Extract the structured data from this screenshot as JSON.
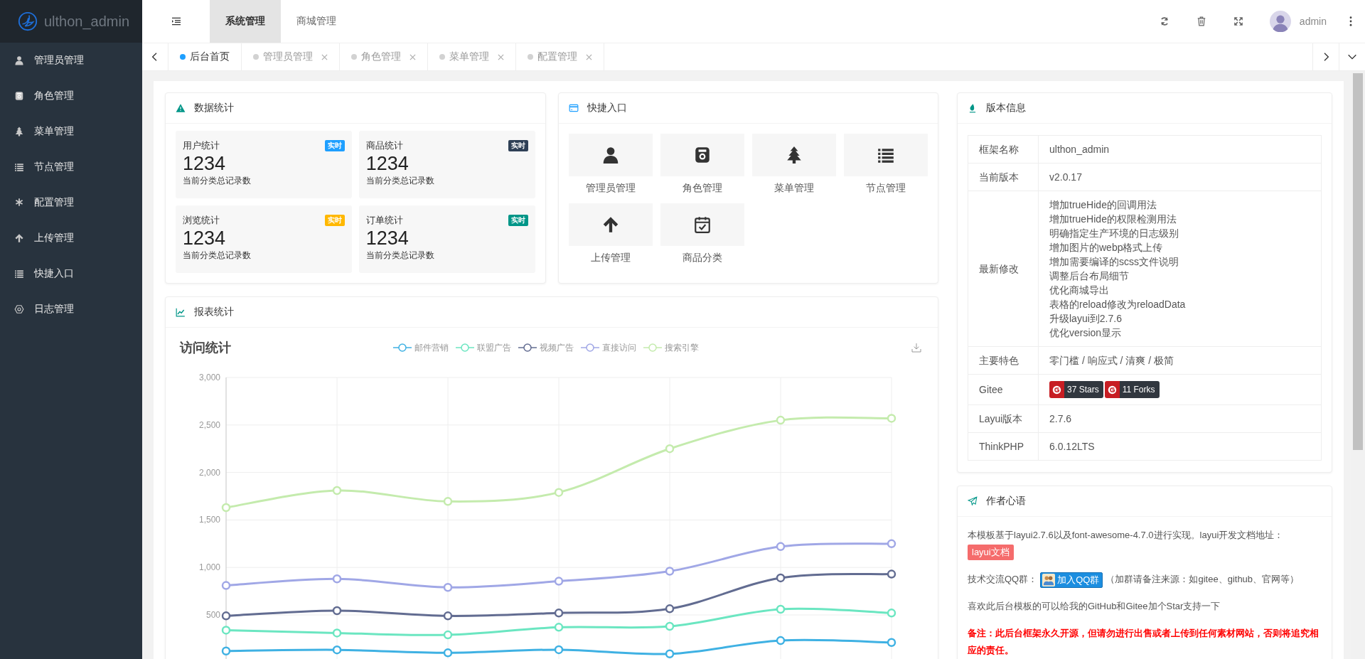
{
  "sidebar": {
    "logo": "ulthon_admin",
    "items": [
      {
        "label": "管理员管理"
      },
      {
        "label": "角色管理"
      },
      {
        "label": "菜单管理"
      },
      {
        "label": "节点管理"
      },
      {
        "label": "配置管理"
      },
      {
        "label": "上传管理"
      },
      {
        "label": "快捷入口"
      },
      {
        "label": "日志管理"
      }
    ]
  },
  "header": {
    "top_tabs": [
      {
        "label": "系统管理",
        "selected": true
      },
      {
        "label": "商城管理",
        "selected": false
      }
    ],
    "user": "admin"
  },
  "page_tabs": [
    {
      "label": "后台首页",
      "selected": true,
      "closable": false
    },
    {
      "label": "管理员管理",
      "selected": false,
      "closable": true
    },
    {
      "label": "角色管理",
      "selected": false,
      "closable": true
    },
    {
      "label": "菜单管理",
      "selected": false,
      "closable": true
    },
    {
      "label": "配置管理",
      "selected": false,
      "closable": true
    }
  ],
  "stats": {
    "title": "数据统计",
    "tiles": [
      {
        "title": "用户统计",
        "badge": "实时",
        "color": "#1e9fff",
        "value": "1234",
        "note": "当前分类总记录数"
      },
      {
        "title": "商品统计",
        "badge": "实时",
        "color": "#2f4056",
        "value": "1234",
        "note": "当前分类总记录数"
      },
      {
        "title": "浏览统计",
        "badge": "实时",
        "color": "#ffb800",
        "value": "1234",
        "note": "当前分类总记录数"
      },
      {
        "title": "订单统计",
        "badge": "实时",
        "color": "#009688",
        "value": "1234",
        "note": "当前分类总记录数"
      }
    ]
  },
  "shortcuts": {
    "title": "快捷入口",
    "items": [
      "管理员管理",
      "角色管理",
      "菜单管理",
      "节点管理",
      "上传管理",
      "商品分类"
    ]
  },
  "report": {
    "title": "报表统计",
    "chart_data": {
      "type": "line",
      "title": "访问统计",
      "ylim": [
        0,
        3000
      ],
      "grid": true,
      "yticks": [
        500,
        {
          "value": 1000,
          "label": "1,000"
        },
        {
          "value": 1500,
          "label": "1,500"
        },
        {
          "value": 2000,
          "label": "2,000"
        },
        {
          "value": 2500,
          "label": "2,500"
        },
        {
          "value": 3000,
          "label": "3,000"
        }
      ],
      "series": [
        {
          "name": "邮件营销",
          "color": "#3fb1e3",
          "marker": true,
          "values": [
            120,
            132,
            101,
            134,
            90,
            230,
            210
          ]
        },
        {
          "name": "联盟广告",
          "color": "#6be6c1",
          "marker": true,
          "values": [
            340,
            310,
            290,
            370,
            380,
            560,
            520
          ]
        },
        {
          "name": "视频广告",
          "color": "#626c91",
          "marker": true,
          "values": [
            490,
            545,
            490,
            520,
            565,
            890,
            930
          ]
        },
        {
          "name": "直接访问",
          "color": "#a0a7e6",
          "marker": true,
          "values": [
            810,
            880,
            790,
            855,
            960,
            1220,
            1250
          ]
        },
        {
          "name": "搜索引擎",
          "color": "#c4ebad",
          "marker": true,
          "values": [
            1630,
            1810,
            1695,
            1790,
            2250,
            2550,
            2570
          ]
        }
      ]
    }
  },
  "version": {
    "title": "版本信息",
    "rows": [
      {
        "kind": "text",
        "label": "框架名称",
        "value": "ulthon_admin"
      },
      {
        "kind": "text",
        "label": "当前版本",
        "value": "v2.0.17"
      },
      {
        "kind": "lines",
        "label": "最新修改",
        "lines": [
          "增加trueHide的回调用法",
          "增加trueHide的权限检测用法",
          "明确指定生产环境的日志级别",
          "增加图片的webp格式上传",
          "增加需要编译的scss文件说明",
          "调整后台布局细节",
          "优化商城导出",
          "表格的reload修改为reloadData",
          "升级layui到2.7.6",
          "优化version显示"
        ]
      },
      {
        "kind": "text",
        "label": "主要特色",
        "value": "零门槛 / 响应式 / 清爽 / 极简"
      },
      {
        "kind": "badges",
        "label": "Gitee",
        "badges": [
          "37 Stars",
          "11 Forks"
        ]
      },
      {
        "kind": "text",
        "label": "Layui版本",
        "value": "2.7.6"
      },
      {
        "kind": "text",
        "label": "ThinkPHP",
        "value": "6.0.12LTS"
      }
    ]
  },
  "author": {
    "title": "作者心语",
    "paragraphs": [
      {
        "kind": "link",
        "text": "本模板基于layui2.7.6以及font-awesome-4.7.0进行实现。layui开发文档地址：",
        "link": "layui文档"
      },
      {
        "kind": "qq",
        "text": "技术交流QQ群：",
        "button": "加入QQ群",
        "after": "（加群请备注来源：如gitee、github、官网等）"
      },
      {
        "kind": "plain",
        "text": "喜欢此后台模板的可以给我的GitHub和Gitee加个Star支持一下"
      },
      {
        "kind": "warning",
        "text": "备注：此后台框架永久开源，但请勿进行出售或者上传到任何素材网站，否则将追究相应的责任。"
      }
    ]
  }
}
